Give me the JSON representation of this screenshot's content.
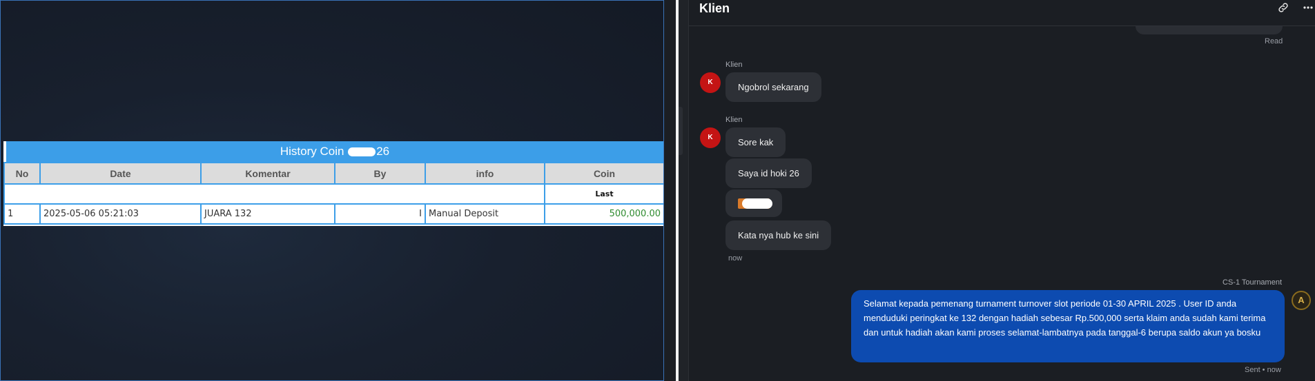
{
  "history": {
    "title_prefix": "History Coin",
    "title_suffix": "26",
    "columns": [
      "No",
      "Date",
      "Komentar",
      "By",
      "info",
      "Coin"
    ],
    "subheader": "Last",
    "rows": [
      {
        "no": "1",
        "date": "2025-05-06 05:21:03",
        "komentar": "JUARA 132",
        "by": "I",
        "info": "Manual Deposit",
        "coin": "500,000.00"
      }
    ]
  },
  "chat": {
    "title": "Klien",
    "read_label": "Read",
    "messages": [
      {
        "sender": "Klien",
        "avatar": "K",
        "texts": [
          "Ngobrol sekarang"
        ]
      },
      {
        "sender": "Klien",
        "avatar": "K",
        "texts": [
          "Sore kak",
          "Saya id hoki 26",
          "Kata nya hub ke sini"
        ]
      }
    ],
    "now_label": "now",
    "outgoing": {
      "sender": "CS-1 Tournament",
      "text": "Selamat kepada pemenang turnament turnover slot periode 01-30 APRIL 2025 . User ID anda menduduki peringkat ke 132 dengan hadiah sebesar Rp.500,000 serta klaim anda sudah kami terima dan untuk hadiah akan kami proses selamat-lambatnya pada tanggal-6 berupa saldo akun ya bosku",
      "status": "Sent • now",
      "avatar": "A"
    }
  },
  "icons": {
    "link": "link-icon",
    "more": "more-icon"
  },
  "colors": {
    "header_blue": "#3c9ee8",
    "coin_green": "#2e8b2e",
    "outgoing_bubble": "#0d4bb0",
    "avatar_red": "#c41414"
  }
}
